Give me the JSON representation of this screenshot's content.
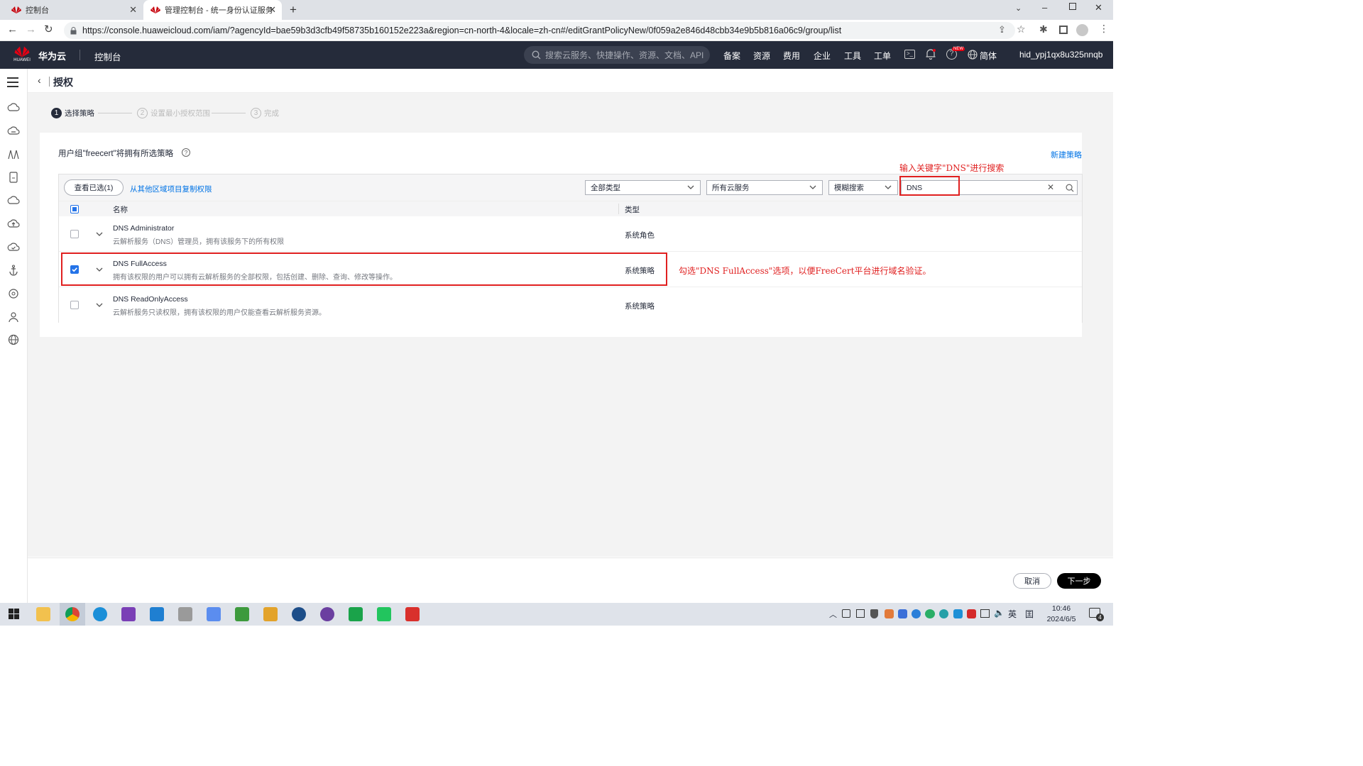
{
  "browser": {
    "tabs": [
      {
        "title": "控制台",
        "active": false
      },
      {
        "title": "管理控制台 - 统一身份认证服务",
        "active": true
      }
    ],
    "new_tab": "+",
    "url": "https://console.huaweicloud.com/iam/?agencyId=bae59b3d3cfb49f58735b160152e223a&region=cn-north-4&locale=zh-cn#/editGrantPolicyNew/0f059a2e846d48cbb34e9b5b816a06c9/group/list"
  },
  "header": {
    "brand": "华为云",
    "logo_text": "HUAWEI",
    "console": "控制台",
    "search_placeholder": "搜索云服务、快捷操作、资源、文档、API",
    "nav": [
      "备案",
      "资源",
      "费用",
      "企业",
      "工具",
      "工单"
    ],
    "new_badge": "NEW",
    "language": "简体",
    "user": "hid_ypj1qx8u325nnqb"
  },
  "page": {
    "title": "授权",
    "steps": [
      {
        "num": "1",
        "label": "选择策略",
        "active": true
      },
      {
        "num": "2",
        "label": "设置最小授权范围",
        "active": false
      },
      {
        "num": "3",
        "label": "完成",
        "active": false
      }
    ],
    "description": "用户组\"freecert\"将拥有所选策略",
    "new_policy_link": "新建策略",
    "view_selected": "查看已选(1)",
    "copy_link": "从其他区域项目复制权限",
    "filters": {
      "type": "全部类型",
      "service": "所有云服务",
      "search_mode": "模糊搜索",
      "keyword": "DNS"
    },
    "columns": {
      "name": "名称",
      "type": "类型"
    },
    "rows": [
      {
        "name": "DNS Administrator",
        "desc": "云解析服务（DNS）管理员，拥有该服务下的所有权限",
        "type": "系统角色",
        "checked": false
      },
      {
        "name": "DNS FullAccess",
        "desc": "拥有该权限的用户可以拥有云解析服务的全部权限，包括创建、删除、查询、修改等操作。",
        "type": "系统策略",
        "checked": true
      },
      {
        "name": "DNS ReadOnlyAccess",
        "desc": "云解析服务只读权限，拥有该权限的用户仅能查看云解析服务资源。",
        "type": "系统策略",
        "checked": false
      }
    ],
    "annotations": {
      "search_hint": "输入关键字\"DNS\"进行搜索",
      "select_hint": "勾选\"DNS FullAccess\"选项，以便FreeCert平台进行域名验证。"
    },
    "cancel": "取消",
    "next": "下一步"
  },
  "taskbar": {
    "time": "10:46",
    "date": "2024/6/5",
    "ime": "英",
    "ime2": "囯",
    "notification_count": "4"
  },
  "colors": {
    "header_bg": "#252b3a",
    "link": "#0073e5",
    "primary_button": "#000000",
    "annotation": "#e02020",
    "checkbox": "#2473e8"
  }
}
